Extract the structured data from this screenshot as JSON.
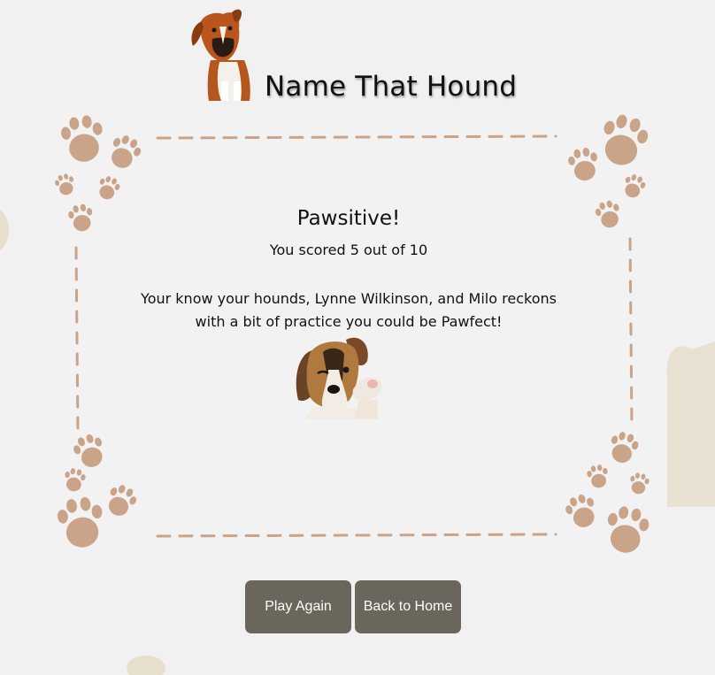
{
  "header": {
    "title": "Name That Hound",
    "logo_icon": "boxer-dog-icon"
  },
  "result": {
    "heading": "Pawsitive!",
    "score_text": "You scored 5 out of 10",
    "message": "Your know your hounds, Lynne Wilkinson, and Milo reckons with a bit of practice you could be Pawfect!",
    "image_icon": "winking-beagle-puppy-icon"
  },
  "buttons": {
    "play_again": "Play Again",
    "back_home": "Back to Home"
  },
  "colors": {
    "background": "#f1f1f1",
    "paw_prints": "#c9a488",
    "button_bg": "#6b665c",
    "button_text": "#ffffff",
    "bone_blob": "#e8e0d0"
  }
}
